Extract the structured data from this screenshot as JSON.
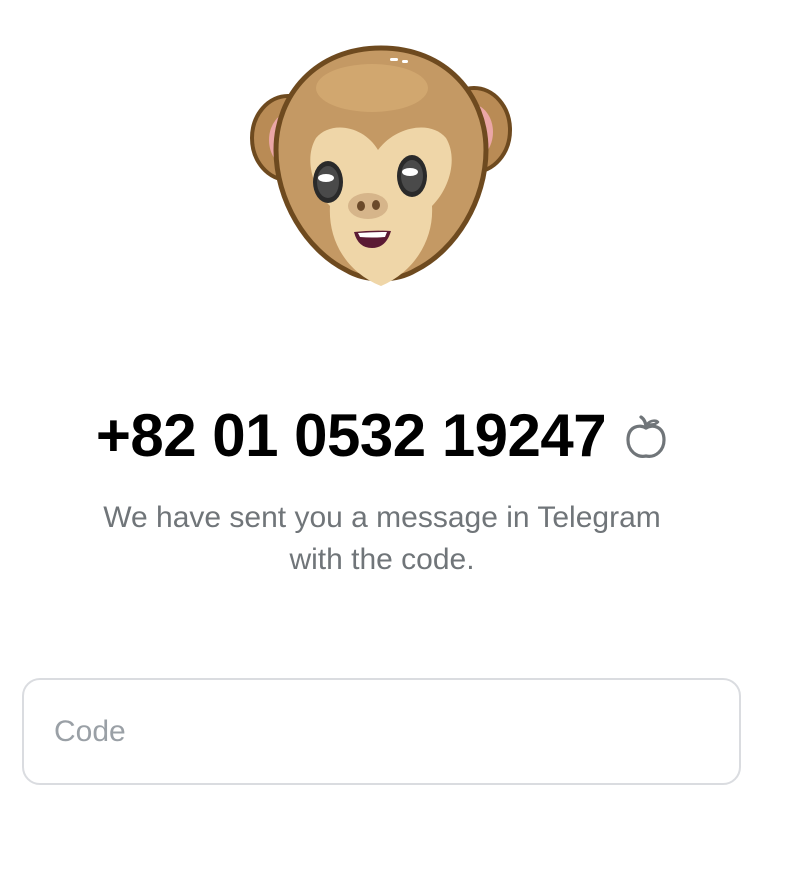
{
  "header": {
    "illustration_icon": "see-no-evil-monkey-icon"
  },
  "phone": {
    "number": "+82 01 0532 19247",
    "edit_icon": "edit-phone-icon"
  },
  "message": {
    "line1": "We have sent you a message in Telegram",
    "line2": "with the code."
  },
  "code_field": {
    "placeholder": "Code",
    "value": ""
  },
  "colors": {
    "text_primary": "#000000",
    "text_secondary": "#707579",
    "input_border": "#dadce0",
    "placeholder": "#9aa0a6"
  }
}
